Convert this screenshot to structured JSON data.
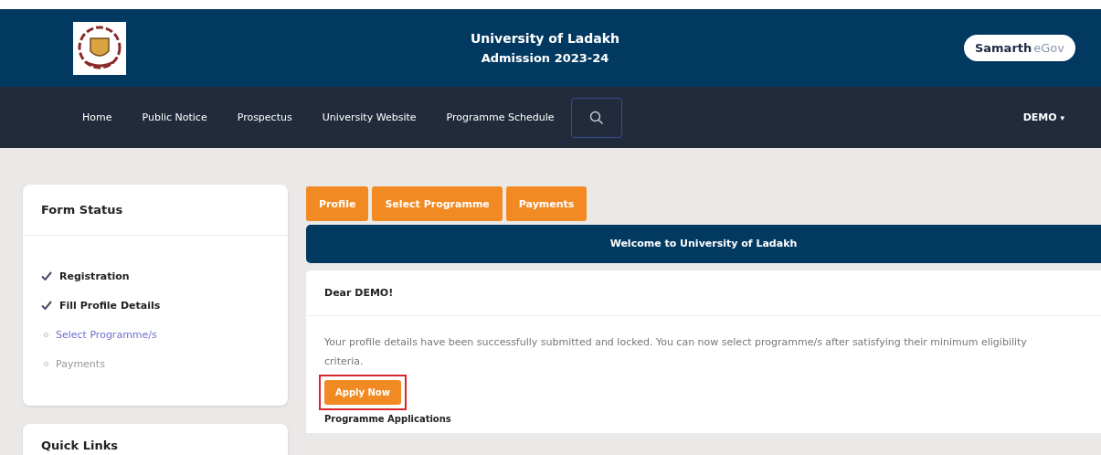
{
  "header": {
    "title": "University of Ladakh",
    "subtitle": "Admission 2023-24",
    "brand": {
      "name": "Samarth",
      "suffix": "eGov"
    }
  },
  "nav": {
    "items": [
      "Home",
      "Public Notice",
      "Prospectus",
      "University Website",
      "Programme Schedule"
    ],
    "user": "DEMO",
    "user_caret": "▾"
  },
  "form_status": {
    "title": "Form Status",
    "steps": [
      {
        "label": "Registration",
        "kind": "done"
      },
      {
        "label": "Fill Profile Details",
        "kind": "done"
      },
      {
        "label": "Select Programme/s",
        "kind": "current"
      },
      {
        "label": "Payments",
        "kind": "pending"
      }
    ]
  },
  "quick_links": {
    "title": "Quick Links"
  },
  "tabs": [
    "Profile",
    "Select Programme",
    "Payments"
  ],
  "welcome": "Welcome to University of Ladakh",
  "card": {
    "greeting": "Dear DEMO!",
    "message": "Your profile details have been successfully submitted and locked. You can now select programme/s after satisfying their minimum eligibility criteria.",
    "apply_button": {
      "label": "Apply Now",
      "highlighted": true
    },
    "section_title": "Programme Applications"
  }
}
